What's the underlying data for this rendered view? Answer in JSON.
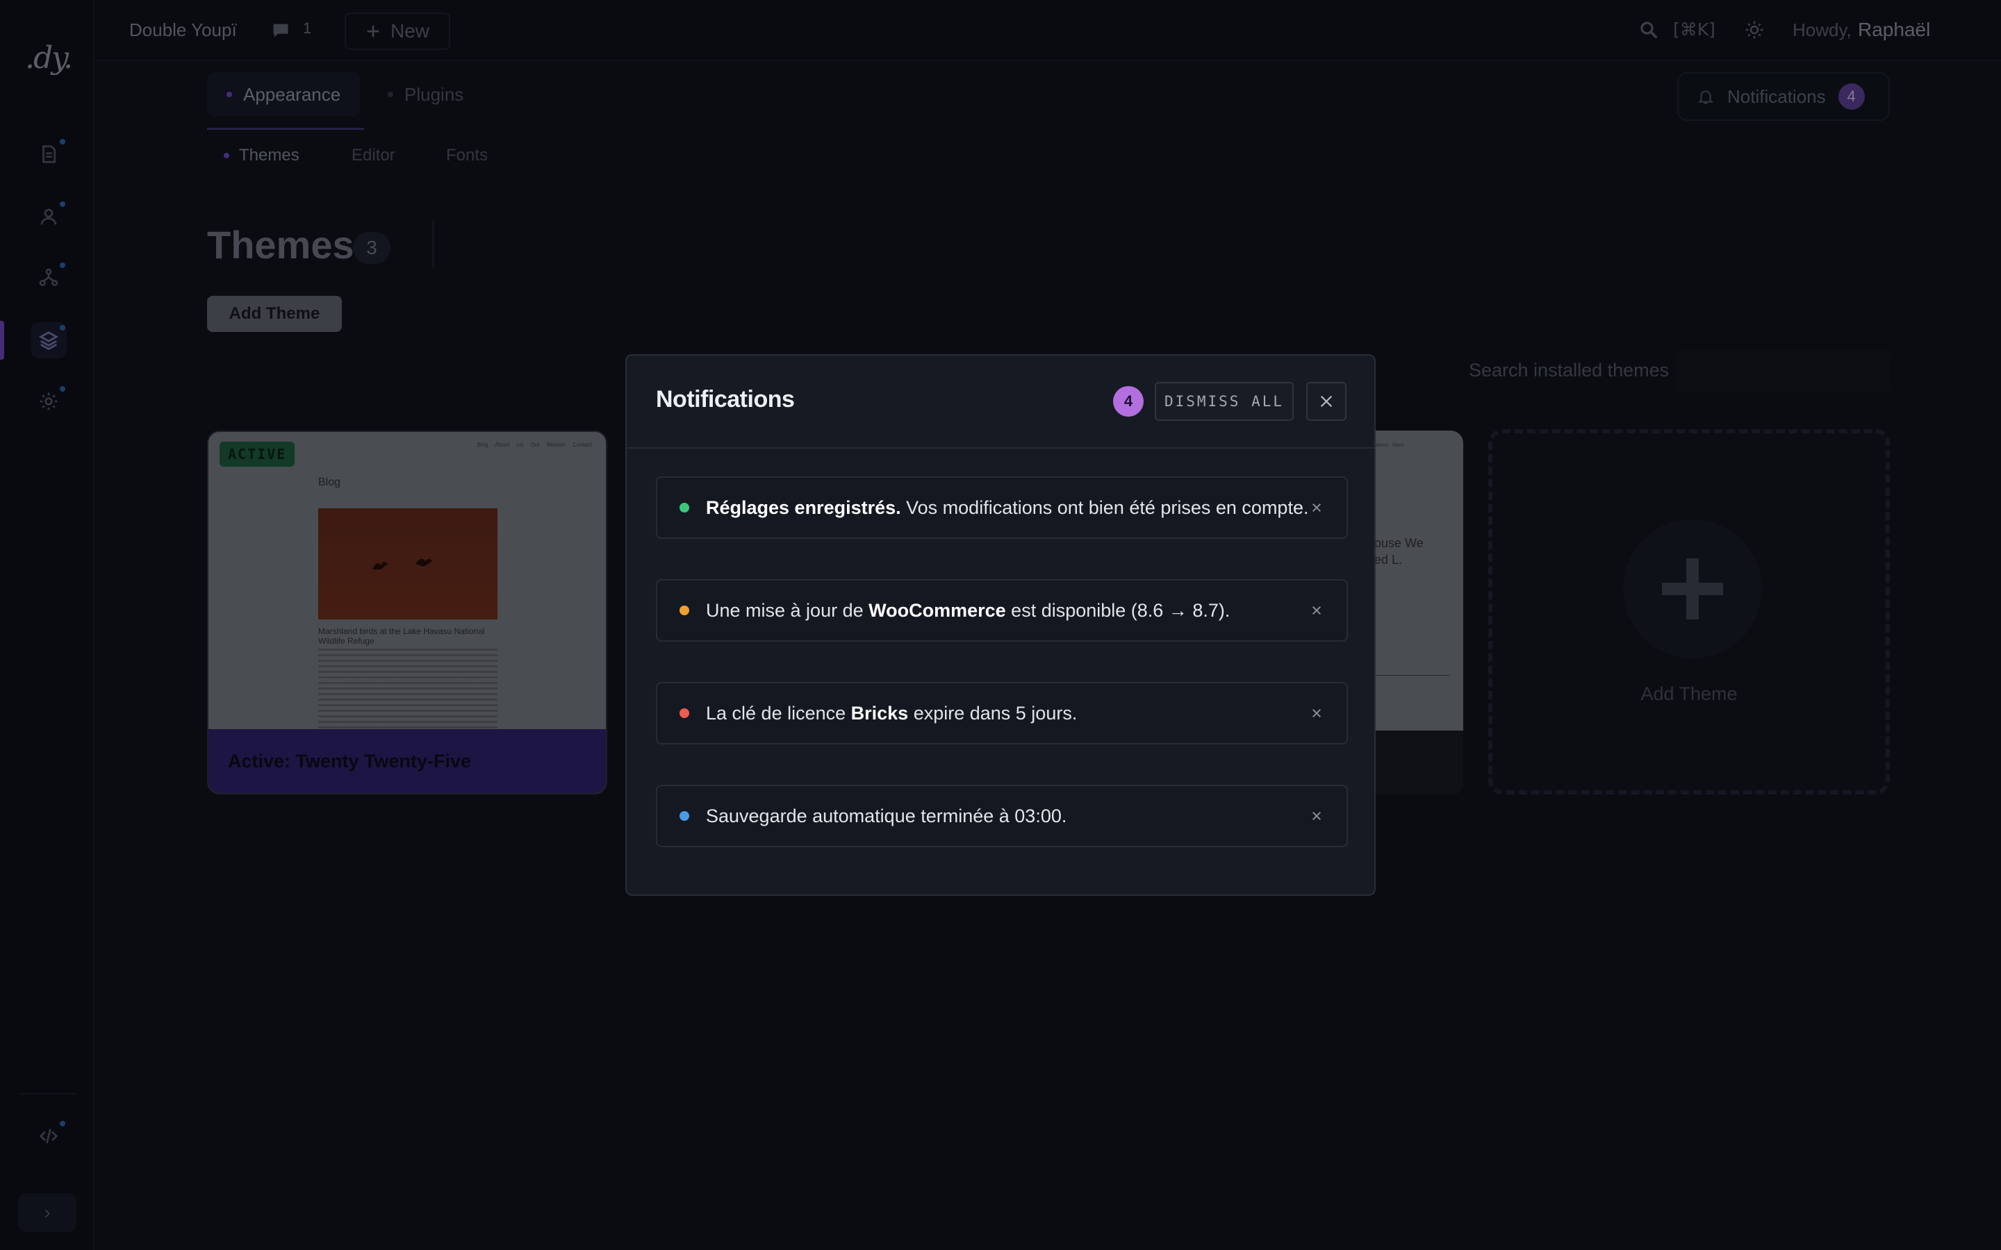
{
  "app": {
    "logo": ".dy.",
    "site_name": "Double Youpï",
    "comments_count": "1",
    "new_label": "New",
    "search_shortcut": "[⌘K]",
    "howdy": "Howdy,",
    "username": "Raphaël"
  },
  "sidebar": {
    "items": [
      {
        "icon": "document-icon"
      },
      {
        "icon": "user-icon"
      },
      {
        "icon": "network-icon"
      },
      {
        "icon": "layers-icon",
        "active": true
      },
      {
        "icon": "settings-icon"
      },
      {
        "icon": "code-icon"
      }
    ]
  },
  "nav": {
    "tabs": [
      {
        "label": "Appearance",
        "active": true
      },
      {
        "label": "Plugins"
      }
    ],
    "subtabs": [
      {
        "label": "Themes",
        "active": true
      },
      {
        "label": "Editor"
      },
      {
        "label": "Fonts"
      }
    ],
    "notifications_label": "Notifications",
    "notifications_count": "4"
  },
  "page": {
    "title": "Themes",
    "count": "3",
    "add_button": "Add Theme",
    "search_label": "Search installed themes",
    "search_value": ""
  },
  "themes": {
    "active": {
      "badge": "ACTIVE",
      "footer": "Active: Twenty Twenty-Five",
      "preview_nav": "Blog About Us Our Mission Contact",
      "preview_heading": "Blog",
      "preview_caption": "Marshland birds at the Lake Havasu National Wildlife Refuge"
    },
    "third_preview_text": "ouse We\ned L.",
    "third_preview_nav": "Patterns   Store",
    "add_card_label": "Add Theme"
  },
  "modal": {
    "title": "Notifications",
    "count": "4",
    "dismiss_all": "DISMISS ALL",
    "notifications": [
      {
        "color": "#3bc77b",
        "bold": "Réglages enregistrés.",
        "pre": "",
        "post": " Vos modifications ont bien été prises en compte."
      },
      {
        "color": "#f0a02f",
        "pre": "Une mise à jour de ",
        "bold": "WooCommerce",
        "post": " est disponible (8.6 → 8.7)."
      },
      {
        "color": "#ee5c4d",
        "pre": "La clé de licence ",
        "bold": "Bricks",
        "post": " expire dans 5 jours."
      },
      {
        "color": "#4a9ae6",
        "pre": "Sauvegarde automatique terminée à 03:00.",
        "bold": "",
        "post": ""
      }
    ]
  },
  "colors": {
    "accent": "#b36ee0",
    "success": "#3bc77b",
    "warning": "#f0a02f",
    "danger": "#ee5c4d",
    "info": "#4a9ae6"
  }
}
